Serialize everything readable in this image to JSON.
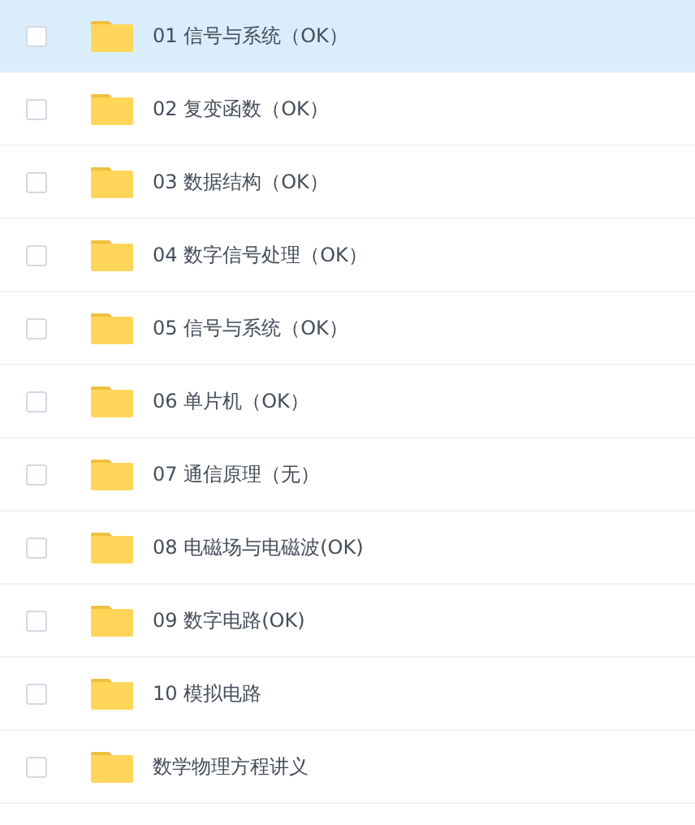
{
  "files": [
    {
      "name": "01 信号与系统（OK）",
      "checked": false,
      "hovered": true
    },
    {
      "name": "02 复变函数（OK）",
      "checked": false,
      "hovered": false
    },
    {
      "name": "03 数据结构（OK）",
      "checked": false,
      "hovered": false
    },
    {
      "name": "04 数字信号处理（OK）",
      "checked": false,
      "hovered": false
    },
    {
      "name": "05 信号与系统（OK）",
      "checked": false,
      "hovered": false
    },
    {
      "name": "06 单片机（OK）",
      "checked": false,
      "hovered": false
    },
    {
      "name": "07 通信原理（无）",
      "checked": false,
      "hovered": false
    },
    {
      "name": "08 电磁场与电磁波(OK)",
      "checked": false,
      "hovered": false
    },
    {
      "name": "09 数字电路(OK)",
      "checked": false,
      "hovered": false
    },
    {
      "name": "10 模拟电路",
      "checked": false,
      "hovered": false
    },
    {
      "name": "数学物理方程讲义",
      "checked": false,
      "hovered": false
    }
  ]
}
